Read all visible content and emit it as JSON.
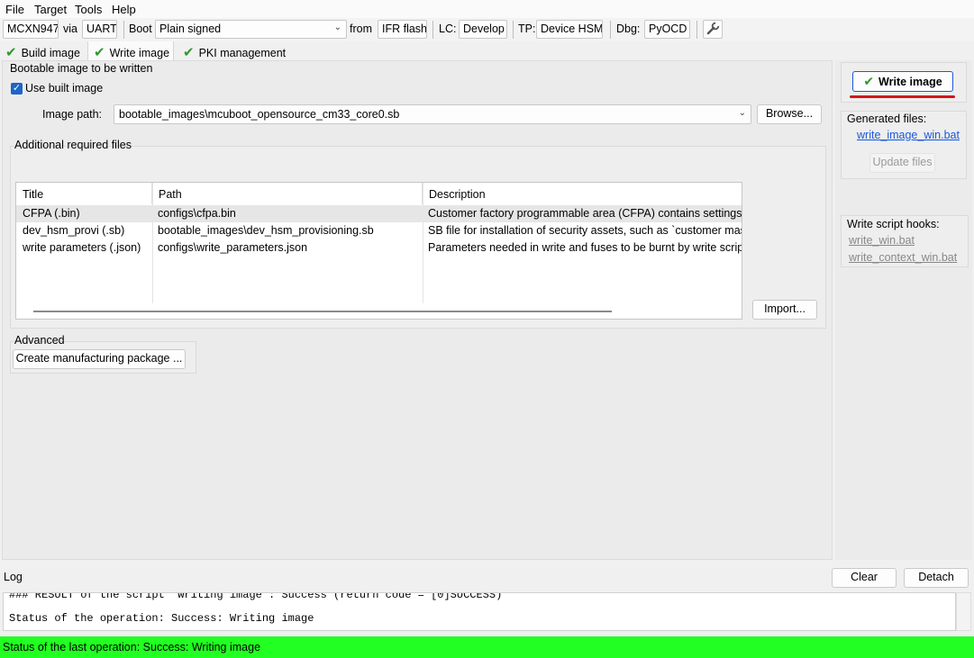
{
  "menu": [
    "File",
    "Target",
    "Tools",
    "Help"
  ],
  "toolbar": {
    "device": "MCXN947",
    "via_label": "via",
    "interface": "UART",
    "boot_label": "Boot",
    "boot_type": "Plain signed",
    "from_label": "from",
    "key_source": "IFR flash",
    "lc_label": "LC:",
    "lifecycle": "Develop",
    "tp_label": "TP:",
    "trust_provisioning": "Device HSM",
    "dbg_label": "Dbg:",
    "debug_probe": "PyOCD",
    "settings_icon": "wrench-icon"
  },
  "tabs": [
    {
      "label": "Build image",
      "checked": true
    },
    {
      "label": "Write image",
      "checked": true,
      "active": true
    },
    {
      "label": "PKI management",
      "checked": true
    }
  ],
  "main": {
    "section_title": "Bootable image to be written",
    "use_built_image_label": "Use built image",
    "use_built_image_checked": true,
    "image_path_label": "Image path:",
    "image_path_value": "bootable_images\\mcuboot_opensource_cm33_core0.sb",
    "browse_label": "Browse...",
    "additional_files_title": "Additional required files",
    "table": {
      "columns": [
        "Title",
        "Path",
        "Description"
      ],
      "rows": [
        {
          "title": "CFPA (.bin)",
          "path": "configs\\cfpa.bin",
          "description": "Customer factory programmable area (CFPA) contains settings for"
        },
        {
          "title": "dev_hsm_provi (.sb)",
          "path": "bootable_images\\dev_hsm_provisioning.sb",
          "description": "SB file for installation of security assets, such as `customer master"
        },
        {
          "title": "write parameters (.json)",
          "path": "configs\\write_parameters.json",
          "description": "Parameters needed in write and fuses to be burnt by write script (c"
        }
      ]
    },
    "import_label": "Import...",
    "advanced_title": "Advanced",
    "create_package_label": "Create manufacturing package ..."
  },
  "side": {
    "write_button_label": "Write image",
    "generated_files_title": "Generated files:",
    "generated_file": "write_image_win.bat",
    "update_files_label": "Update files",
    "hooks_title": "Write script hooks:",
    "hooks": [
      "write_win.bat",
      "write_context_win.bat"
    ]
  },
  "log": {
    "title": "Log",
    "clear_label": "Clear",
    "detach_label": "Detach",
    "lines": [
      "### RESULT of the script `writing image`: Success (return code = [0]SUCCESS)",
      "Status of the operation: Success: Writing image"
    ]
  },
  "status": {
    "text": "Status of the last operation: Success: Writing image",
    "color": "#22ff22"
  }
}
